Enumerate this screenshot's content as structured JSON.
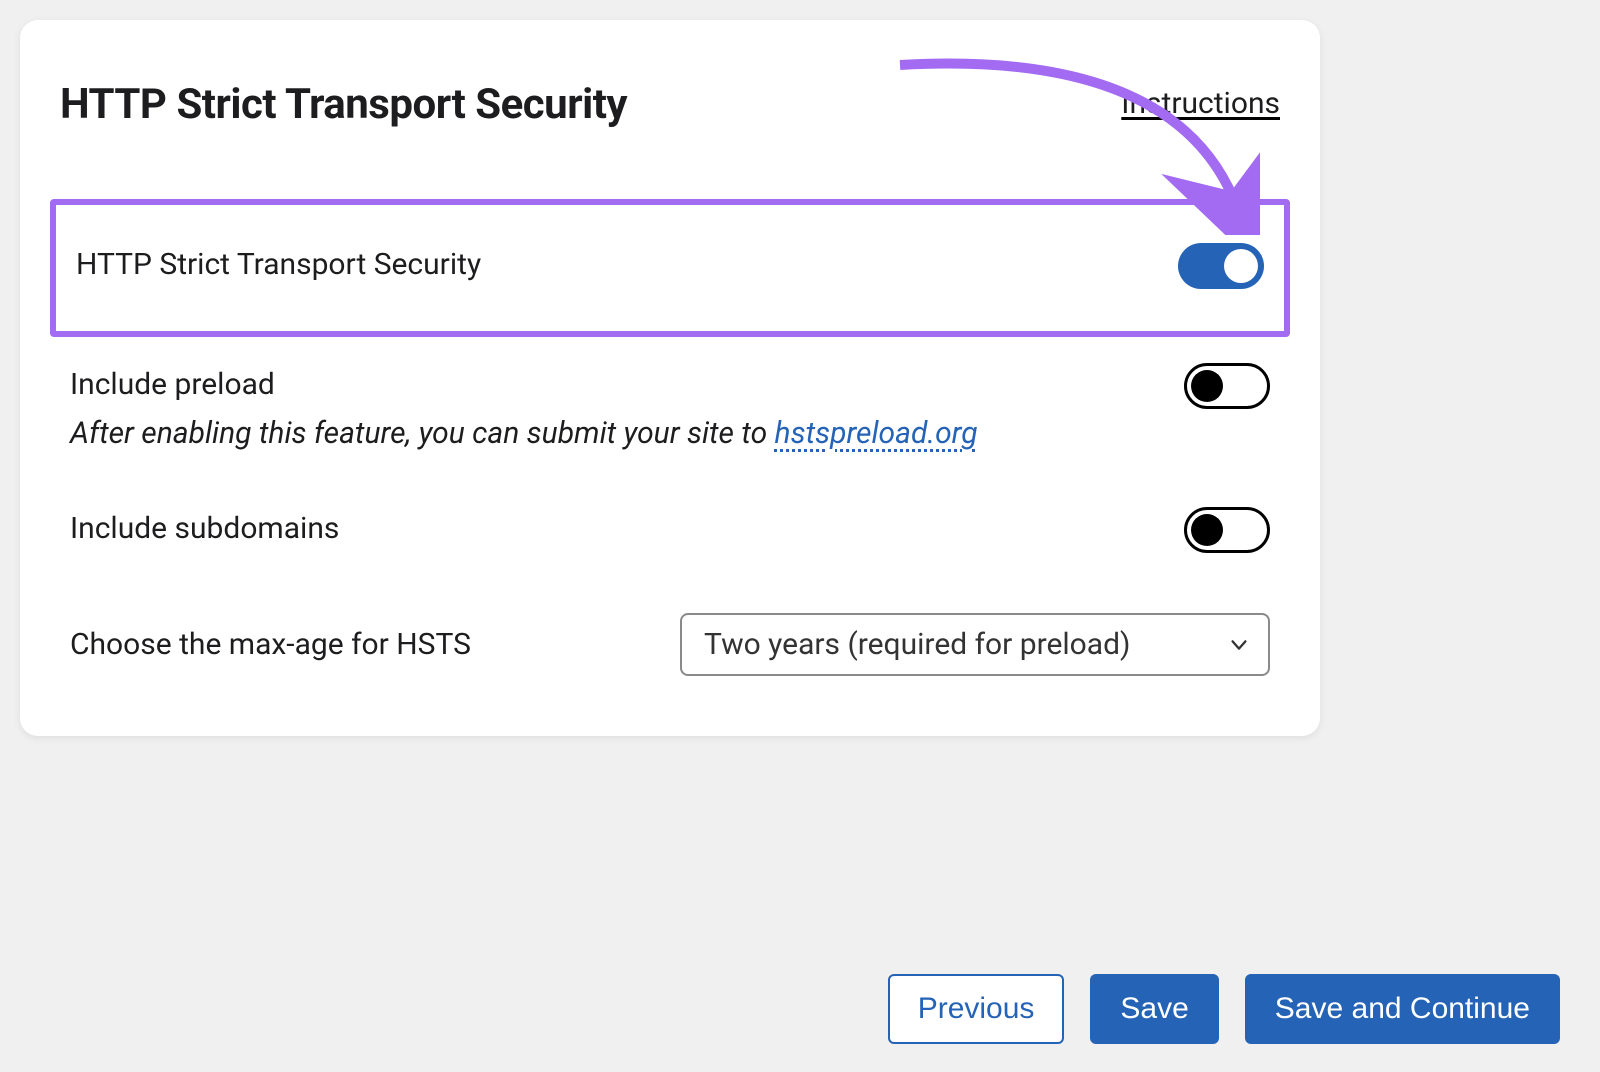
{
  "header": {
    "title": "HTTP Strict Transport Security",
    "instructions_label": "Instructions"
  },
  "rows": {
    "hsts": {
      "label": "HTTP Strict Transport Security",
      "enabled": true
    },
    "preload": {
      "label": "Include preload",
      "desc_prefix": "After enabling this feature, you can submit your site to ",
      "link_text": "hstspreload.org",
      "enabled": false
    },
    "subdomains": {
      "label": "Include subdomains",
      "enabled": false
    },
    "maxage": {
      "label": "Choose the max-age for HSTS",
      "selected": "Two years (required for preload)"
    }
  },
  "footer": {
    "previous": "Previous",
    "save": "Save",
    "save_continue": "Save and Continue"
  },
  "colors": {
    "accent": "#2563b6",
    "highlight": "#a36bf2"
  }
}
